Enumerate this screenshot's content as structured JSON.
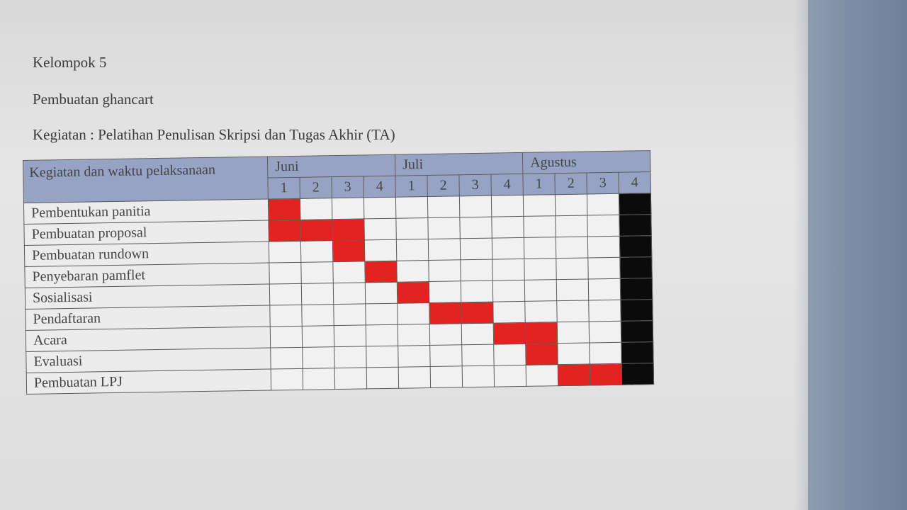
{
  "document": {
    "group": "Kelompok 5",
    "subtitle": "Pembuatan ghancart",
    "activity": "Kegiatan : Pelatihan Penulisan Skripsi dan Tugas Akhir (TA)"
  },
  "gantt": {
    "task_header": "Kegiatan dan waktu pelaksanaan",
    "months": [
      {
        "name": "Juni",
        "weeks": [
          "1",
          "2",
          "3",
          "4"
        ]
      },
      {
        "name": "Juli",
        "weeks": [
          "1",
          "2",
          "3",
          "4"
        ]
      },
      {
        "name": "Agustus",
        "weeks": [
          "1",
          "2",
          "3",
          "4"
        ]
      }
    ],
    "tasks": [
      {
        "name": "Pembentukan panitia",
        "active_weeks": [
          1
        ]
      },
      {
        "name": "Pembuatan proposal",
        "active_weeks": [
          1,
          2,
          3
        ]
      },
      {
        "name": "Pembuatan rundown",
        "active_weeks": [
          3
        ]
      },
      {
        "name": "Penyebaran pamflet",
        "active_weeks": [
          4
        ]
      },
      {
        "name": "Sosialisasi",
        "active_weeks": [
          5
        ]
      },
      {
        "name": "Pendaftaran",
        "active_weeks": [
          6,
          7
        ]
      },
      {
        "name": "Acara",
        "active_weeks": [
          8,
          9
        ]
      },
      {
        "name": "Evaluasi",
        "active_weeks": [
          9
        ]
      },
      {
        "name": "Pembuatan LPJ",
        "active_weeks": [
          10,
          11
        ]
      }
    ],
    "filled_week_column": 12,
    "colors": {
      "active": "#e3231f",
      "filled_column": "#0b0b0b",
      "header": "#96a3c4"
    }
  }
}
